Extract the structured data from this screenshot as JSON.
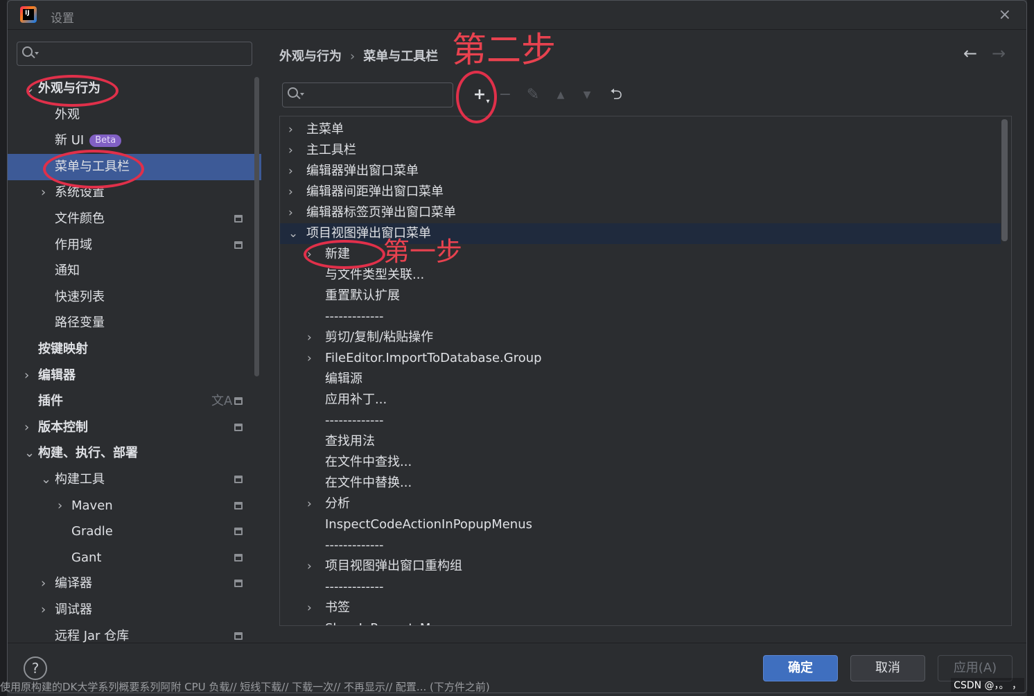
{
  "window": {
    "title": "设置",
    "close_icon": "×"
  },
  "left": {
    "search_placeholder": "",
    "nav": [
      {
        "label": "外观与行为",
        "chevron": "⌄",
        "bold": true
      },
      {
        "label": "外观"
      },
      {
        "label": "新 UI",
        "badge": "Beta"
      },
      {
        "label": "菜单与工具栏",
        "selected": true
      },
      {
        "label": "系统设置",
        "chevron": "›"
      },
      {
        "label": "文件颜色",
        "project_icon": true
      },
      {
        "label": "作用域",
        "project_icon": true
      },
      {
        "label": "通知"
      },
      {
        "label": "快速列表"
      },
      {
        "label": "路径变量"
      },
      {
        "label": "按键映射",
        "bold": true
      },
      {
        "label": "编辑器",
        "chevron": "›",
        "bold": true
      },
      {
        "label": "插件",
        "bold": true,
        "project_icon": true,
        "translate_icon": "文A"
      },
      {
        "label": "版本控制",
        "chevron": "›",
        "bold": true,
        "project_icon": true
      },
      {
        "label": "构建、执行、部署",
        "chevron": "⌄",
        "bold": true
      },
      {
        "label": "构建工具",
        "chevron": "⌄",
        "project_icon": true
      },
      {
        "label": "Maven",
        "chevron": "›",
        "project_icon": true
      },
      {
        "label": "Gradle",
        "project_icon": true
      },
      {
        "label": "Gant",
        "project_icon": true
      },
      {
        "label": "编译器",
        "chevron": "›",
        "project_icon": true
      },
      {
        "label": "调试器",
        "chevron": "›"
      },
      {
        "label": "远程 Jar 仓库",
        "project_icon": true
      }
    ]
  },
  "breadcrumb": {
    "parent": "外观与行为",
    "separator": "›",
    "current": "菜单与工具栏"
  },
  "nav_arrows": {
    "back": "←",
    "forward": "→"
  },
  "toolbar": {
    "add": "+",
    "remove": "−",
    "edit": "✎",
    "up": "▲",
    "down": "▼",
    "restore": "⮌"
  },
  "tree": [
    {
      "label": "主菜单",
      "chevron": "›"
    },
    {
      "label": "主工具栏",
      "chevron": "›"
    },
    {
      "label": "编辑器弹出窗口菜单",
      "chevron": "›"
    },
    {
      "label": "编辑器间距弹出窗口菜单",
      "chevron": "›"
    },
    {
      "label": "编辑器标签页弹出窗口菜单",
      "chevron": "›"
    },
    {
      "label": "项目视图弹出窗口菜单",
      "chevron": "⌄",
      "selected": true
    },
    {
      "label": "新建",
      "chevron": "›",
      "child": true
    },
    {
      "label": "与文件类型关联...",
      "child": true
    },
    {
      "label": "重置默认扩展",
      "child": true
    },
    {
      "label": "-------------",
      "child": true
    },
    {
      "label": "剪切/复制/粘贴操作",
      "chevron": "›",
      "child": true
    },
    {
      "label": "FileEditor.ImportToDatabase.Group",
      "chevron": "›",
      "child": true
    },
    {
      "label": "编辑源",
      "child": true
    },
    {
      "label": "应用补丁...",
      "child": true
    },
    {
      "label": "-------------",
      "child": true
    },
    {
      "label": "查找用法",
      "child": true
    },
    {
      "label": "在文件中查找...",
      "child": true
    },
    {
      "label": "在文件中替换...",
      "child": true
    },
    {
      "label": "分析",
      "chevron": "›",
      "child": true
    },
    {
      "label": "InspectCodeActionInPopupMenus",
      "child": true
    },
    {
      "label": "-------------",
      "child": true
    },
    {
      "label": "项目视图弹出窗口重构组",
      "chevron": "›",
      "child": true
    },
    {
      "label": "-------------",
      "child": true
    },
    {
      "label": "书签",
      "chevron": "›",
      "child": true
    },
    {
      "label": "ShowInRecentsMenu",
      "child": true
    }
  ],
  "footer": {
    "help": "?",
    "ok": "确定",
    "cancel": "取消",
    "apply": "应用(A)"
  },
  "annotations": {
    "step1": "第一步",
    "step2": "第二步"
  },
  "watermark": "CSDN @，。 ，",
  "background_text": "使用原构建的DK大学系列概要系列阿附 CPU 负载// 短线下载// 下载一次// 不再显示// 配置... (下方件之前)"
}
